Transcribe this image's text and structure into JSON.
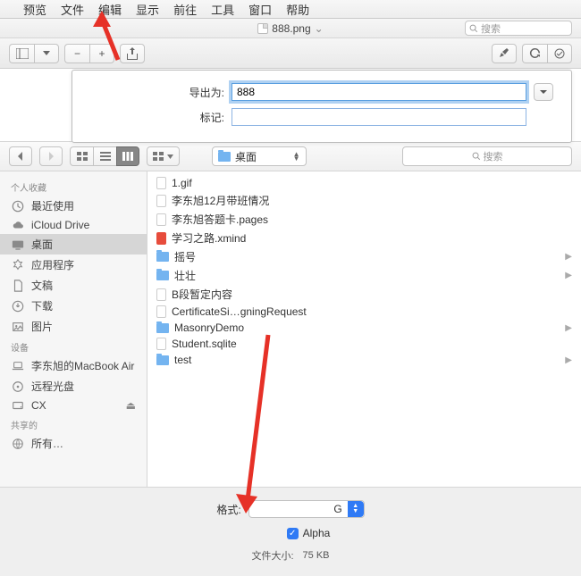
{
  "menubar": {
    "items": [
      "预览",
      "文件",
      "编辑",
      "显示",
      "前往",
      "工具",
      "窗口",
      "帮助"
    ]
  },
  "preview": {
    "doc_title": "888.png",
    "edited_indicator": "⌄",
    "search_placeholder": "搜索"
  },
  "export": {
    "export_as_label": "导出为:",
    "export_as_value": "888",
    "tags_label": "标记:",
    "tags_value": ""
  },
  "browser": {
    "location_label": "桌面",
    "search_placeholder": "搜索"
  },
  "sidebar": {
    "favorites_heading": "个人收藏",
    "favorites": [
      {
        "icon": "clock",
        "label": "最近使用"
      },
      {
        "icon": "cloud",
        "label": "iCloud Drive"
      },
      {
        "icon": "desktop",
        "label": "桌面",
        "active": true
      },
      {
        "icon": "app",
        "label": "应用程序"
      },
      {
        "icon": "doc",
        "label": "文稿"
      },
      {
        "icon": "download",
        "label": "下载"
      },
      {
        "icon": "photo",
        "label": "图片"
      }
    ],
    "devices_heading": "设备",
    "devices": [
      {
        "icon": "laptop",
        "label": "李东旭的MacBook Air"
      },
      {
        "icon": "remote",
        "label": "远程光盘"
      },
      {
        "icon": "disk",
        "label": "CX",
        "eject": true
      }
    ],
    "shared_heading": "共享的",
    "shared": [
      {
        "icon": "globe",
        "label": "所有…"
      }
    ]
  },
  "files": [
    {
      "type": "doc",
      "name": "1.gif"
    },
    {
      "type": "doc",
      "name": "李东旭12月带班情况"
    },
    {
      "type": "doc",
      "name": "李东旭答题卡.pages"
    },
    {
      "type": "xmind",
      "name": "学习之路.xmind"
    },
    {
      "type": "folder",
      "name": "摇号",
      "arrow": true
    },
    {
      "type": "folder",
      "name": "壮壮",
      "arrow": true
    },
    {
      "type": "doc",
      "name": "B段暂定内容"
    },
    {
      "type": "doc",
      "name": "CertificateSi…gningRequest"
    },
    {
      "type": "folder",
      "name": "MasonryDemo",
      "arrow": true
    },
    {
      "type": "sqlite",
      "name": "Student.sqlite"
    },
    {
      "type": "folder",
      "name": "test",
      "arrow": true
    }
  ],
  "format": {
    "label": "格式:",
    "value_visible": "G",
    "alpha_label": "Alpha",
    "filesize_label": "文件大小:",
    "filesize_value": "75 KB"
  }
}
